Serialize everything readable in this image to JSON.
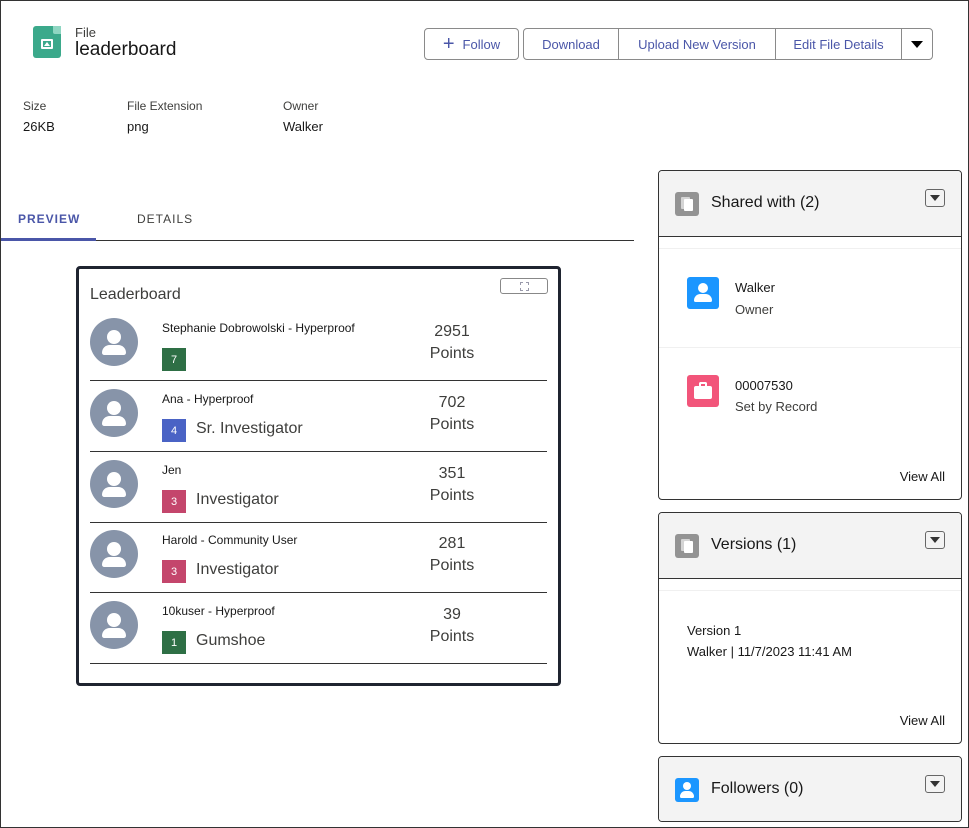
{
  "header": {
    "object_label": "File",
    "title": "leaderboard",
    "actions": {
      "follow": "Follow",
      "download": "Download",
      "upload_new_version": "Upload New Version",
      "edit_file_details": "Edit File Details"
    }
  },
  "fields": [
    {
      "label": "Size",
      "value": "26KB"
    },
    {
      "label": "File Extension",
      "value": "png"
    },
    {
      "label": "Owner",
      "value": "Walker"
    }
  ],
  "tabs": {
    "preview": "PREVIEW",
    "details": "DETAILS",
    "active": "preview"
  },
  "leaderboard": {
    "title": "Leaderboard",
    "rows": [
      {
        "name": "Stephanie Dobrowolski - Hyperproof",
        "rank": "7",
        "level": "",
        "points": "2951",
        "points_label": "Points",
        "badge_color": "#2e6f45"
      },
      {
        "name": "Ana - Hyperproof",
        "rank": "4",
        "level": "Sr. Investigator",
        "points": "702",
        "points_label": "Points",
        "badge_color": "#4a63c5"
      },
      {
        "name": "Jen",
        "rank": "3",
        "level": "Investigator",
        "points": "351",
        "points_label": "Points",
        "badge_color": "#c4466c"
      },
      {
        "name": "Harold - Community User",
        "rank": "3",
        "level": "Investigator",
        "points": "281",
        "points_label": "Points",
        "badge_color": "#c4466c"
      },
      {
        "name": "10kuser - Hyperproof",
        "rank": "1",
        "level": "Gumshoe",
        "points": "39",
        "points_label": "Points",
        "badge_color": "#2e6f45"
      }
    ]
  },
  "shared_with": {
    "title": "Shared with (2)",
    "items": [
      {
        "name": "Walker",
        "role": "Owner",
        "icon": "user-icon"
      },
      {
        "name": "00007530",
        "role": "Set by Record",
        "icon": "case-icon"
      }
    ],
    "view_all": "View All"
  },
  "versions": {
    "title": "Versions (1)",
    "items": [
      {
        "label": "Version 1",
        "detail": "Walker  |  11/7/2023 11:41 AM"
      }
    ],
    "view_all": "View All"
  },
  "followers": {
    "title": "Followers (0)"
  },
  "colors": {
    "brand": "#4a56a8",
    "file_icon": "#3ba98b",
    "user_icon": "#1b96ff",
    "case_icon": "#f2557a"
  }
}
